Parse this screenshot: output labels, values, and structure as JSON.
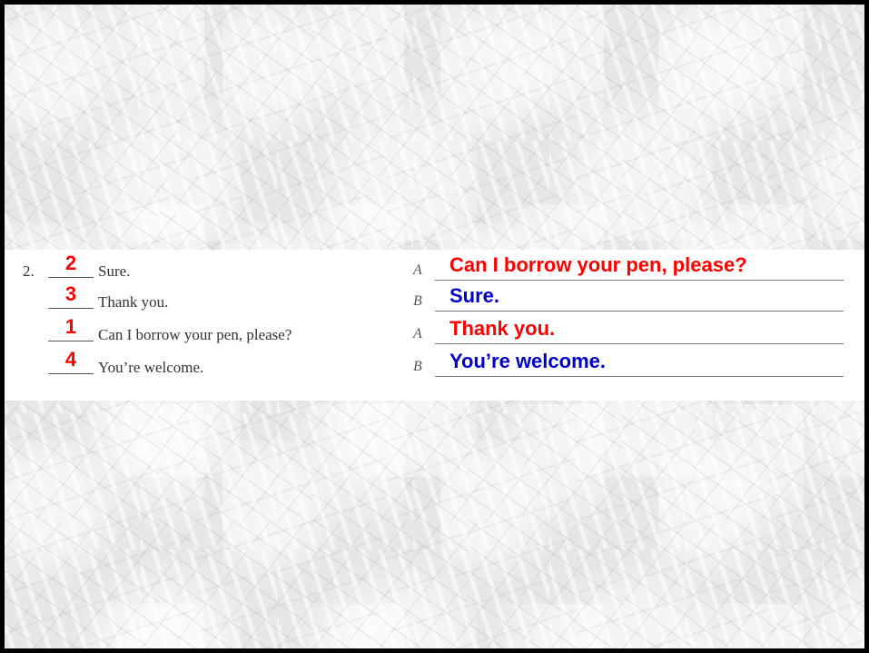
{
  "exercise": {
    "number": "2.",
    "rows": [
      {
        "order": "2",
        "sentence": "Sure.",
        "speaker": "A",
        "answer": "Can I borrow your pen, please?"
      },
      {
        "order": "3",
        "sentence": "Thank you.",
        "speaker": "B",
        "answer": "Sure."
      },
      {
        "order": "1",
        "sentence": "Can I borrow your pen, please?",
        "speaker": "A",
        "answer": "Thank you."
      },
      {
        "order": "4",
        "sentence": "You’re welcome.",
        "speaker": "B",
        "answer": "You’re welcome."
      }
    ]
  },
  "colors": {
    "order_numbers": "#ff0000",
    "speaker_a_answer": "#ff0000",
    "speaker_b_answer": "#0000cc"
  }
}
